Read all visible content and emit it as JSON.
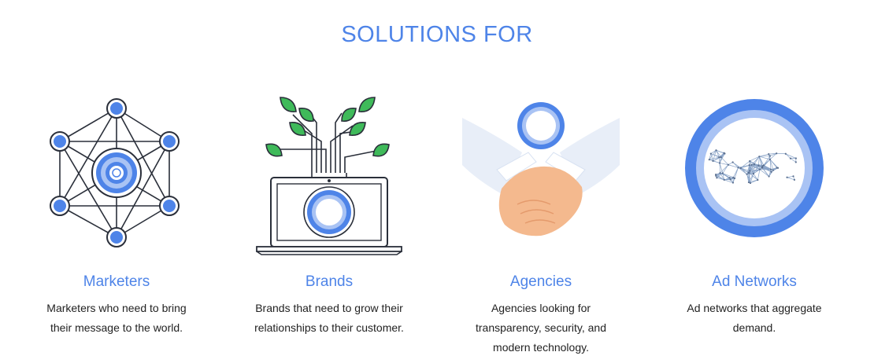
{
  "header": {
    "title": "SOLUTIONS FOR"
  },
  "cards": [
    {
      "title": "Marketers",
      "desc_lines": [
        "Marketers who need to bring",
        "their message to the world."
      ],
      "icon": "network-hub-icon"
    },
    {
      "title": "Brands",
      "desc_lines": [
        "Brands that need to grow their",
        "relationships to their customer."
      ],
      "icon": "laptop-plant-icon"
    },
    {
      "title": "Agencies",
      "desc_lines": [
        "Agencies looking for",
        "transparency, security, and",
        "modern technology."
      ],
      "icon": "handshake-icon"
    },
    {
      "title": "Ad Networks",
      "desc_lines": [
        "Ad networks that aggregate",
        "demand."
      ],
      "icon": "network-ring-icon"
    }
  ],
  "colors": {
    "accent_blue": "#4e84e8",
    "light_blue": "#a9c3f4",
    "leaf_green": "#3fba5a",
    "hand_peach": "#f4b98e",
    "text_dark": "#222222",
    "outline_dark": "#2a2f3a"
  }
}
